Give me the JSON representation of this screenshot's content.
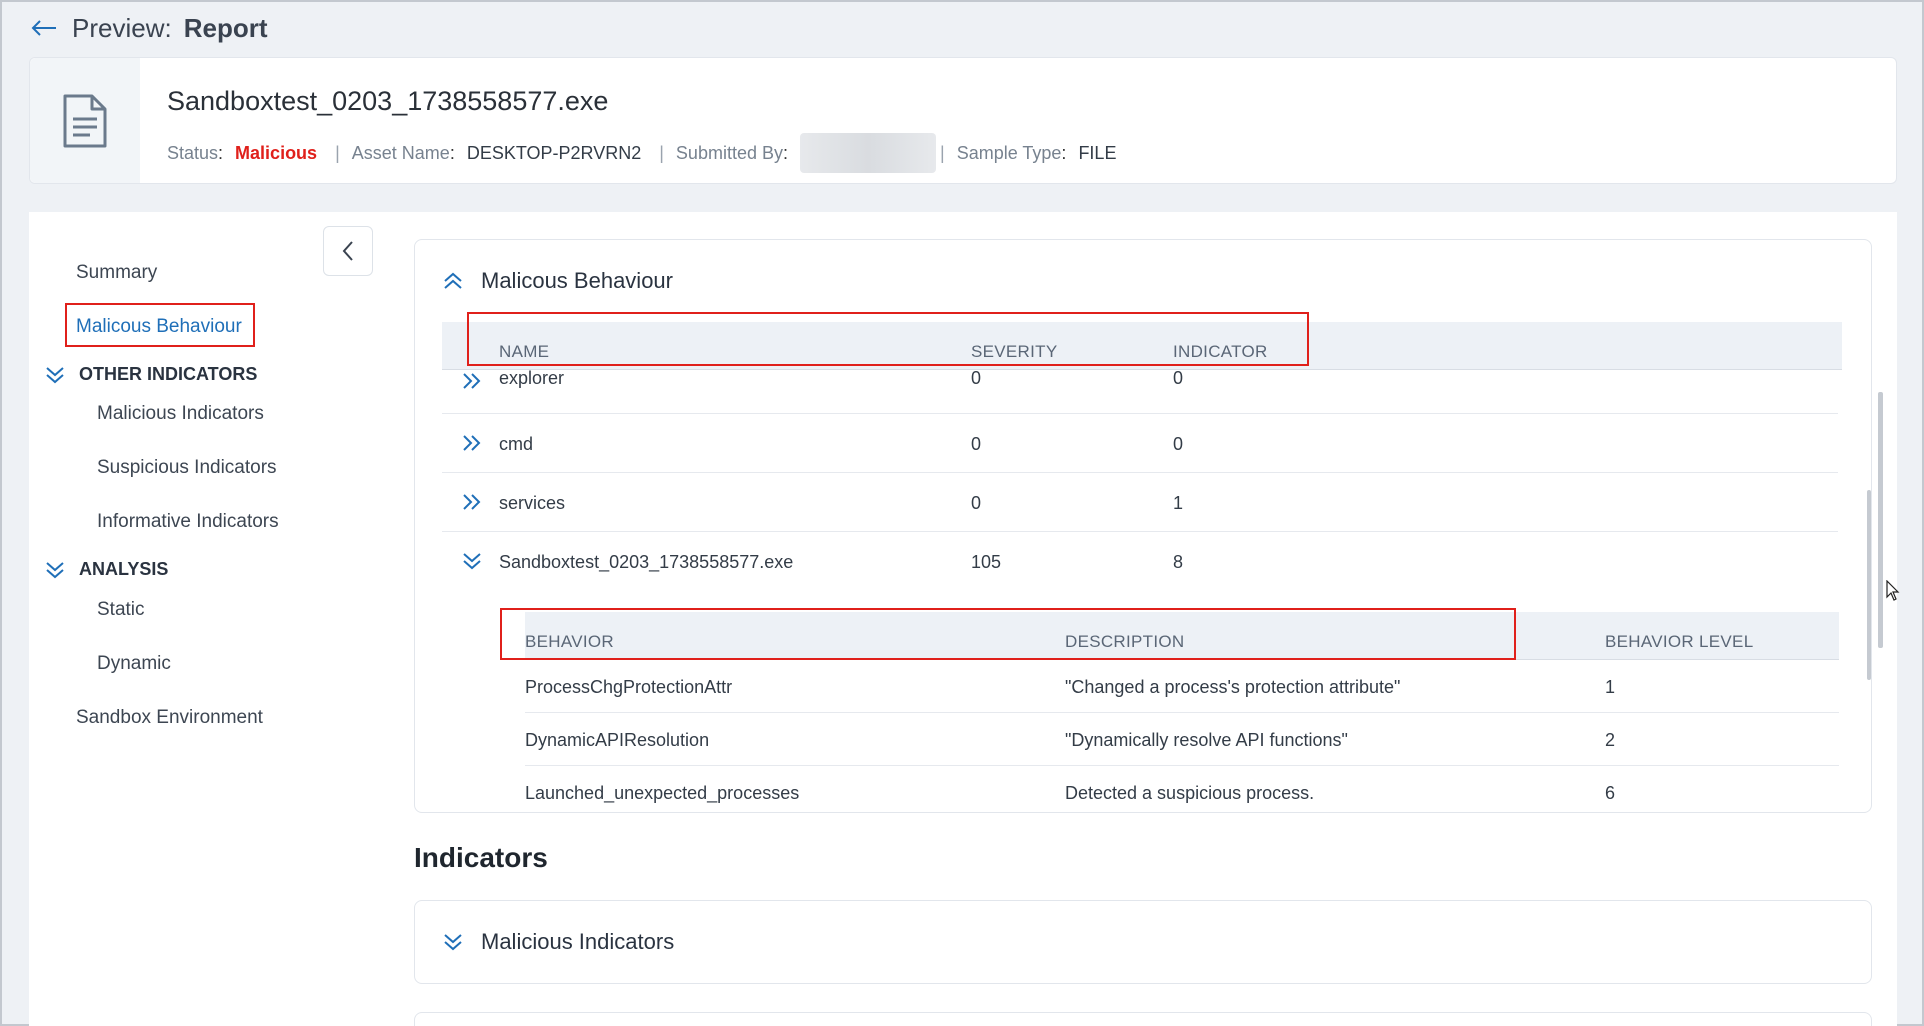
{
  "header": {
    "back_icon": "arrow-left-icon",
    "label": "Preview:",
    "page": "Report"
  },
  "file": {
    "icon": "document-icon",
    "name": "Sandboxtest_0203_1738558577.exe",
    "status_label": "Status",
    "status_value": "Malicious",
    "status_color": "#e0201b",
    "asset_label": "Asset Name",
    "asset_value": "DESKTOP-P2RVRN2",
    "submitted_label": "Submitted By",
    "sample_label": "Sample Type",
    "sample_value": "FILE"
  },
  "sidebar": {
    "collapse_icon": "chevron-left-icon",
    "summary": "Summary",
    "malicious_behaviour": "Malicous Behaviour",
    "other_indicators": {
      "title": "OTHER INDICATORS",
      "items": [
        "Malicious Indicators",
        "Suspicious Indicators",
        "Informative Indicators"
      ]
    },
    "analysis": {
      "title": "ANALYSIS",
      "items": [
        "Static",
        "Dynamic"
      ]
    },
    "sandbox": "Sandbox Environment"
  },
  "behaviour_panel": {
    "title": "Malicous Behaviour",
    "columns": [
      "NAME",
      "SEVERITY",
      "INDICATOR"
    ],
    "rows": [
      {
        "name": "explorer",
        "severity": "0",
        "indicator": "0",
        "expanded": false
      },
      {
        "name": "cmd",
        "severity": "0",
        "indicator": "0",
        "expanded": false
      },
      {
        "name": "services",
        "severity": "0",
        "indicator": "1",
        "expanded": false
      },
      {
        "name": "Sandboxtest_0203_1738558577.exe",
        "severity": "105",
        "indicator": "8",
        "expanded": true
      }
    ],
    "sub_columns": [
      "BEHAVIOR",
      "DESCRIPTION",
      "BEHAVIOR LEVEL"
    ],
    "sub_rows": [
      {
        "behavior": "ProcessChgProtectionAttr",
        "description": "\"Changed a process's protection attribute\"",
        "level": "1"
      },
      {
        "behavior": "DynamicAPIResolution",
        "description": "\"Dynamically resolve API functions\"",
        "level": "2"
      },
      {
        "behavior": "Launched_unexpected_processes",
        "description": "Detected a suspicious process.",
        "level": "6"
      }
    ]
  },
  "indicators": {
    "title": "Indicators",
    "malicious_panel_title": "Malicious Indicators"
  },
  "colors": {
    "accent": "#1f6fb8",
    "highlight": "#e0201b"
  }
}
